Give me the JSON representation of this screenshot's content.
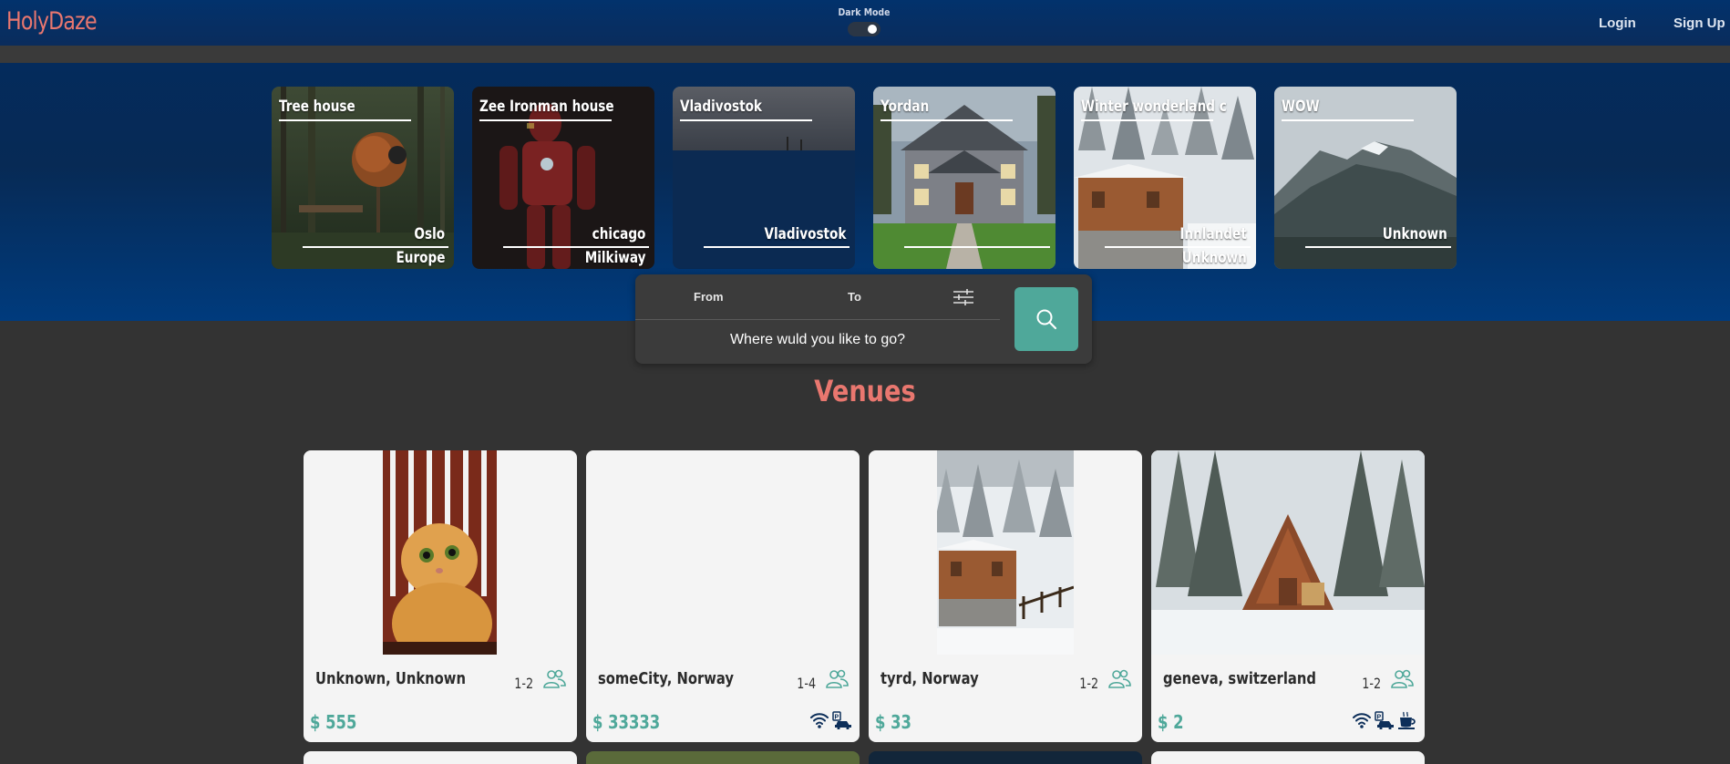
{
  "header": {
    "logo": "HolyDaze",
    "dark_mode_label": "Dark Mode",
    "dark_mode_on": true,
    "login": "Login",
    "signup": "Sign Up"
  },
  "featured": [
    {
      "title": "Tree house",
      "city": "Oslo",
      "continent": "Europe"
    },
    {
      "title": "Zee Ironman house",
      "city": "chicago",
      "continent": "Milkiway"
    },
    {
      "title": "Vladivostok",
      "city": "Vladivostok",
      "continent": ""
    },
    {
      "title": "Yordan",
      "city": "",
      "continent": ""
    },
    {
      "title": "Winter wonderland c",
      "city": "Innlandet",
      "continent": "Unknown"
    },
    {
      "title": "WOW",
      "city": "Unknown",
      "continent": ""
    }
  ],
  "search": {
    "from_label": "From",
    "to_label": "To",
    "placeholder": "Where wuld you like to go?",
    "icons": [
      "filter-sliders-icon",
      "search-icon"
    ]
  },
  "venues_title": "Venues",
  "venues": [
    {
      "location": "Unknown, Unknown",
      "guests": "1-2",
      "price": "$ 555",
      "amenities": []
    },
    {
      "location": "someCity, Norway",
      "guests": "1-4",
      "price": "$ 33333",
      "amenities": [
        "wifi-icon",
        "parking-icon"
      ]
    },
    {
      "location": "tyrd, Norway",
      "guests": "1-2",
      "price": "$ 33",
      "amenities": []
    },
    {
      "location": "geneva, switzerland",
      "guests": "1-2",
      "price": "$ 2",
      "amenities": [
        "wifi-icon",
        "parking-icon",
        "breakfast-icon"
      ]
    }
  ],
  "colors": {
    "brand": "#e9776f",
    "accent": "#4fa89a",
    "navbar": "#02326c",
    "background": "#333333",
    "card": "#f4f4f4"
  }
}
